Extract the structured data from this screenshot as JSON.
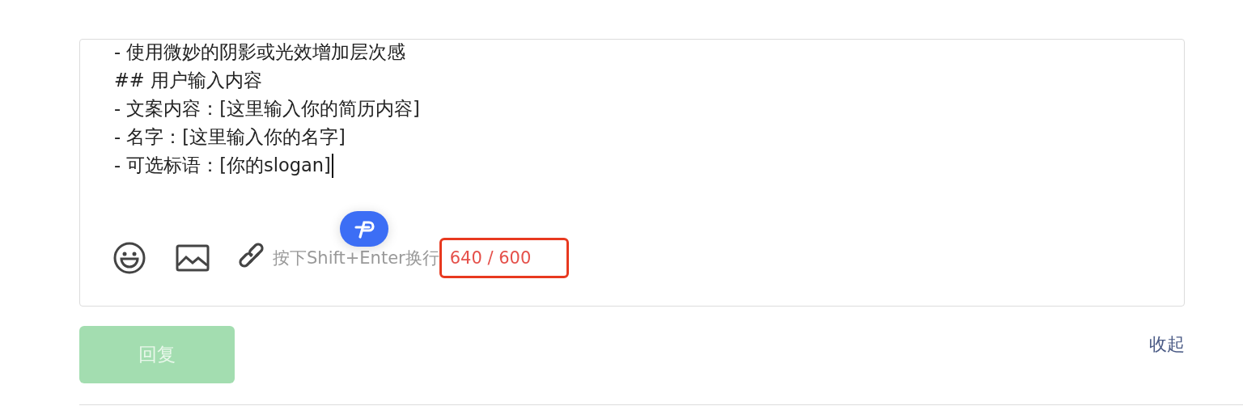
{
  "editor": {
    "lines": [
      "- 使用微妙的阴影或光效增加层次感",
      "## 用户输入内容",
      "- 文案内容：[这里输入你的简历内容]",
      "- 名字：[这里输入你的名字]",
      "- 可选标语：[你的slogan]"
    ],
    "caret": true,
    "hint": "按下Shift+Enter换行",
    "counter": {
      "text": "640 / 600",
      "over_limit": true,
      "highlighted": true
    }
  },
  "reply_button": {
    "label": "回复",
    "disabled": true
  },
  "collapse_link": "收起"
}
